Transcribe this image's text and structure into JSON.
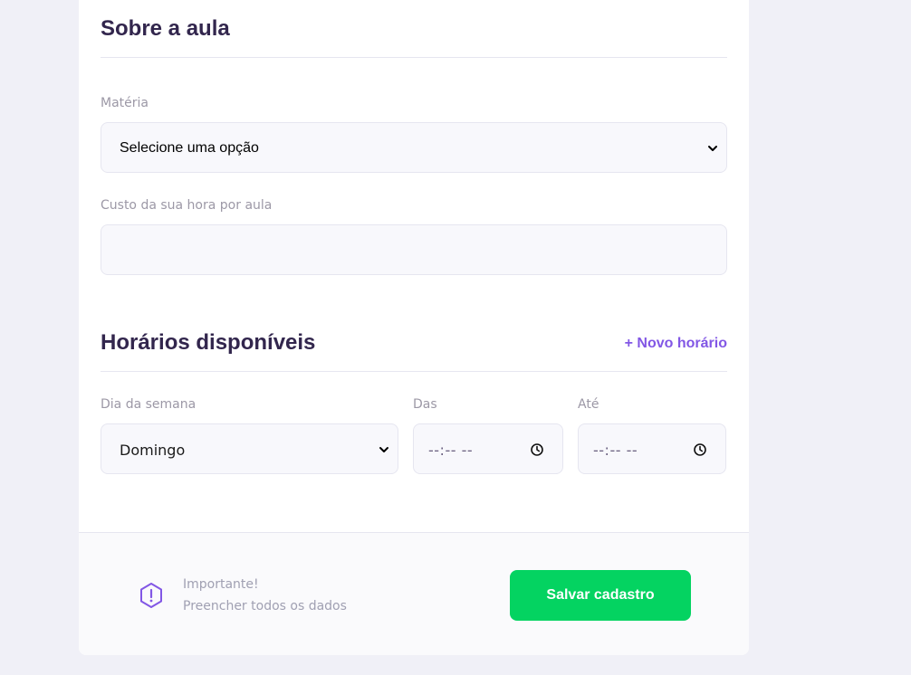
{
  "about": {
    "title": "Sobre a aula",
    "subject_label": "Matéria",
    "subject_value": "Selecione uma opção",
    "cost_label": "Custo da sua hora por aula",
    "cost_value": ""
  },
  "schedule": {
    "title": "Horários disponíveis",
    "add_label": "+ Novo horário",
    "weekday_label": "Dia da semana",
    "weekday_value": "Domingo",
    "from_label": "Das",
    "from_value": "--:-- --",
    "to_label": "Até",
    "to_value": "--:-- --"
  },
  "footer": {
    "warning_title": "Importante!",
    "warning_text": "Preencher todos os dados",
    "save_label": "Salvar cadastro"
  },
  "colors": {
    "background": "#F0F0F7",
    "title": "#32264D",
    "accent": "#8257E5",
    "save": "#04D361",
    "label": "#9C98A6",
    "field_bg": "#F8F8FC"
  }
}
